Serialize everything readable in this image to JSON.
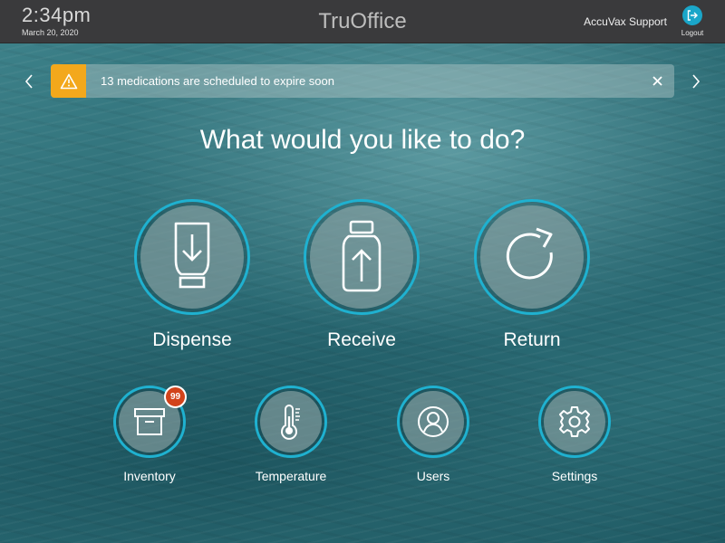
{
  "header": {
    "time": "2:34pm",
    "date": "March 20, 2020",
    "title": "TruOffice",
    "support_link": "AccuVax Support",
    "logout_label": "Logout"
  },
  "alert": {
    "message": "13 medications are scheduled to expire soon"
  },
  "main": {
    "heading": "What would you like to do?",
    "primary_actions": [
      {
        "label": "Dispense",
        "icon": "dispense-icon"
      },
      {
        "label": "Receive",
        "icon": "receive-icon"
      },
      {
        "label": "Return",
        "icon": "return-icon"
      }
    ],
    "secondary_actions": [
      {
        "label": "Inventory",
        "icon": "inventory-box-icon",
        "badge": "99"
      },
      {
        "label": "Temperature",
        "icon": "thermometer-icon"
      },
      {
        "label": "Users",
        "icon": "user-icon"
      },
      {
        "label": "Settings",
        "icon": "gear-icon"
      }
    ]
  },
  "colors": {
    "accent": "#1fb1d0",
    "alert": "#f3a81c",
    "badge": "#d2431b",
    "topbar": "#3a3a3c"
  }
}
